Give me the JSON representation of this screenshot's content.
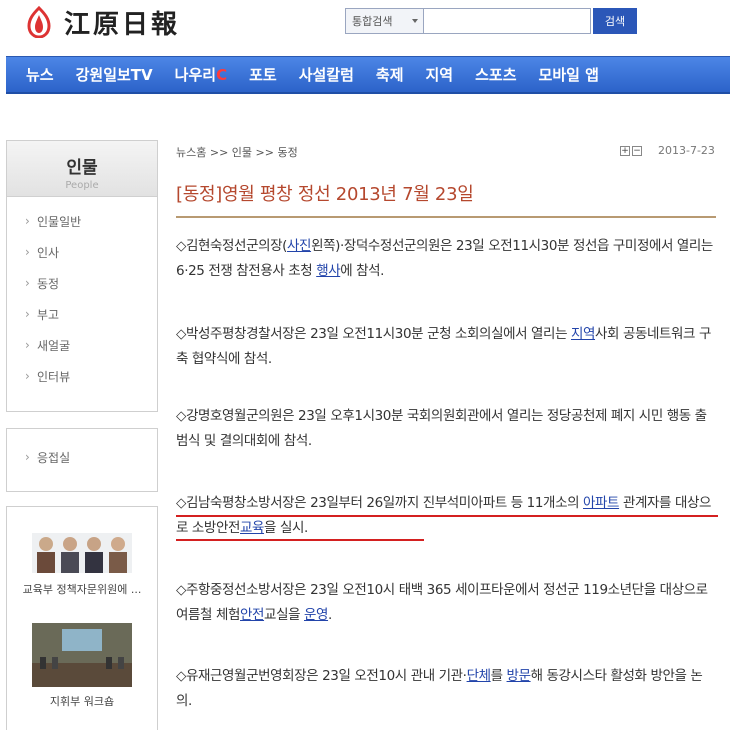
{
  "logo": {
    "text": "江原日報"
  },
  "search": {
    "scope": "통합검색",
    "button": "검색"
  },
  "nav": {
    "items": [
      {
        "label": "뉴스"
      },
      {
        "label": "강원일보TV"
      },
      {
        "label": "나우리",
        "suffix": "C"
      },
      {
        "label": "포토"
      },
      {
        "label": "사설칼럼"
      },
      {
        "label": "축제"
      },
      {
        "label": "지역"
      },
      {
        "label": "스포츠"
      },
      {
        "label": "모바일 앱"
      }
    ]
  },
  "sidebar": {
    "title": "인물",
    "subtitle": "People",
    "menu": [
      "인물일반",
      "인사",
      "동정",
      "부고",
      "새얼굴",
      "인터뷰"
    ],
    "extra": [
      "응접실"
    ],
    "thumbs": [
      {
        "label": "교육부 정책자문위원에 ..."
      },
      {
        "label": "지휘부 워크숍"
      }
    ]
  },
  "breadcrumb": "뉴스홈 >> 인물 >> 동정",
  "tools": {
    "zoom_in": "+",
    "zoom_out": "−",
    "date": "2013-7-23"
  },
  "article": {
    "headline": "[동정]영월 평창 정선 2013년 7월 23일",
    "paragraphs": [
      {
        "p1": "◇김현숙정선군의장(",
        "l1": "사진",
        "p2": "왼쪽)·장덕수정선군의원은 23일 오전11시30분 정선읍 구미정에서 열리는 6·25 전쟁 참전용사 초청 ",
        "l2": "행사",
        "p3": "에 참석."
      },
      {
        "p1": "◇박성주평창경찰서장은 23일 오전11시30분 군청 소회의실에서 열리는 ",
        "l1": "지역",
        "p2": "사회 공동네트워크 구축 협약식에 참석."
      },
      {
        "p1": "◇강명호영월군의원은 23일 오후1시30분 국회의원회관에서 열리는 정당공천제 폐지 시민 행동 출범식 및 결의대회에 참석."
      },
      {
        "p1": "◇김남숙평창소방서장은 23일부터 26일까지 진부석미아파트 등 11개소의 ",
        "l1": "아파트",
        "p2": " 관계자를 대상으로 소방안전",
        "l2": "교육",
        "p3": "을 실시."
      },
      {
        "p1": "◇주항중정선소방서장은 23일 오전10시 태백 365 세이프타운에서 정선군 119소년단을 대상으로 여름철 체험",
        "l1": "안전",
        "p2": "교실을 ",
        "l2": "운영",
        "p3": "."
      },
      {
        "p1": "◇유재근영월군번영회장은 23일 오전10시 관내 기관·",
        "l1": "단체",
        "p2": "를 ",
        "l2": "방문",
        "p3": "해 동강시스타 활성화 방안을 논의."
      }
    ]
  },
  "colors": {
    "nav": "#2c63c9",
    "headline": "#b5482e",
    "highlight": "#d42020",
    "link": "#2244aa"
  }
}
